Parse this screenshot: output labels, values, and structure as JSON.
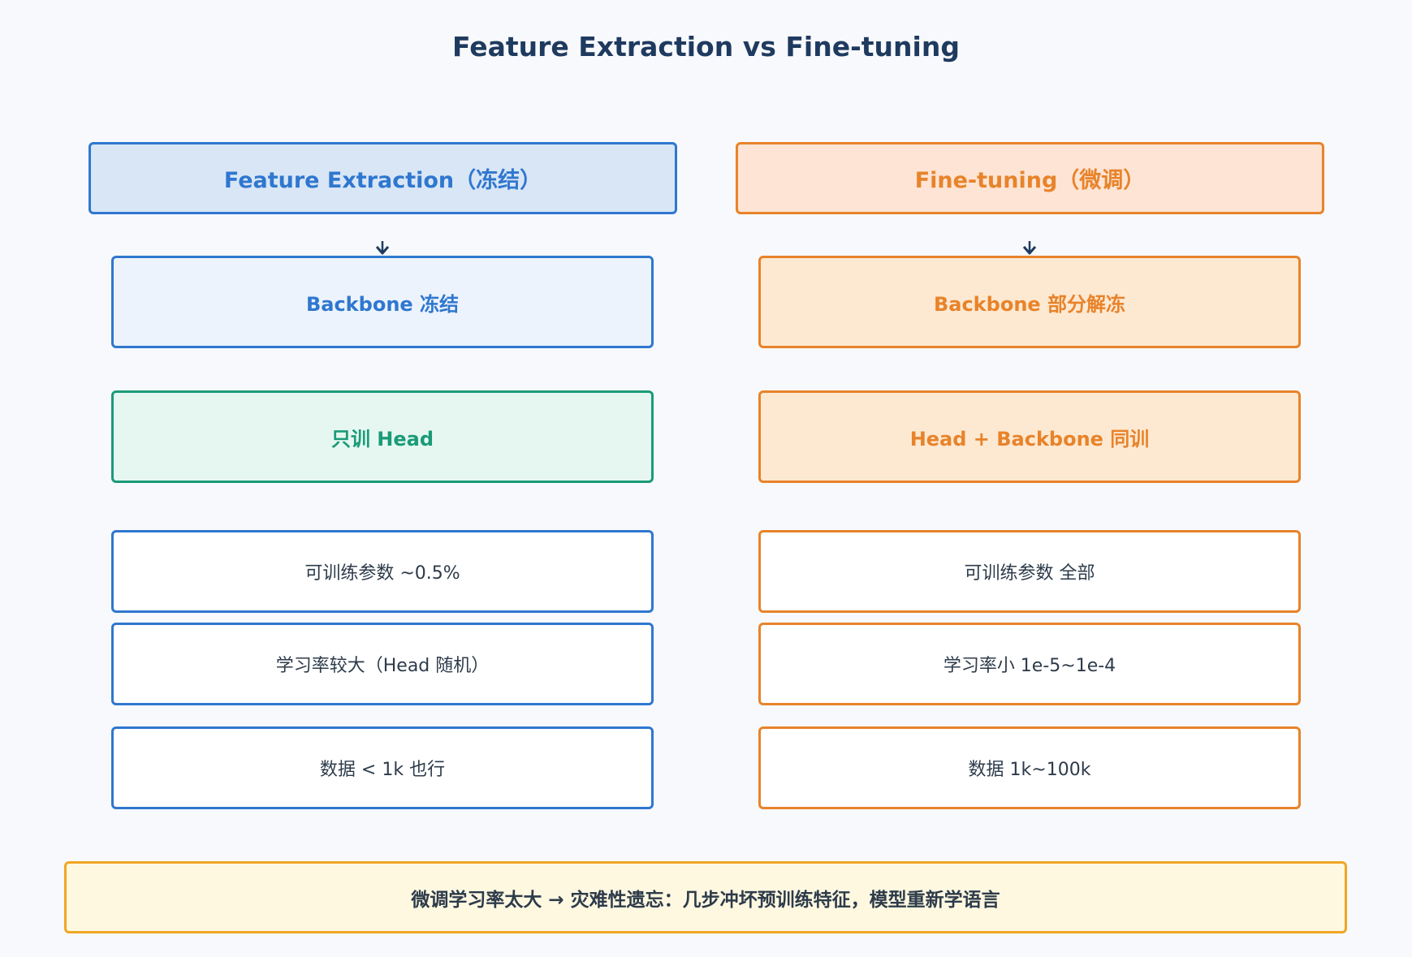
{
  "title": "Feature Extraction vs Fine-tuning",
  "left": {
    "header": "Feature Extraction（冻结）",
    "step1": "Backbone 冻结",
    "step2": "只训 Head",
    "info": [
      "可训练参数 ~0.5%",
      "学习率较大（Head 随机）",
      "数据 < 1k 也行"
    ]
  },
  "right": {
    "header": "Fine-tuning（微调）",
    "step1": "Backbone 部分解冻",
    "step2": "Head + Backbone 同训",
    "info": [
      "可训练参数 全部",
      "学习率小 1e-5~1e-4",
      "数据 1k~100k"
    ]
  },
  "warning": "微调学习率太大 → 灾难性遗忘：几步冲坏预训练特征，模型重新学语言",
  "colors": {
    "title": "#1f3a5f",
    "blue": "#2f77cf",
    "orange": "#e8832a",
    "green": "#1a9b78",
    "warning_border": "#f0a623"
  }
}
